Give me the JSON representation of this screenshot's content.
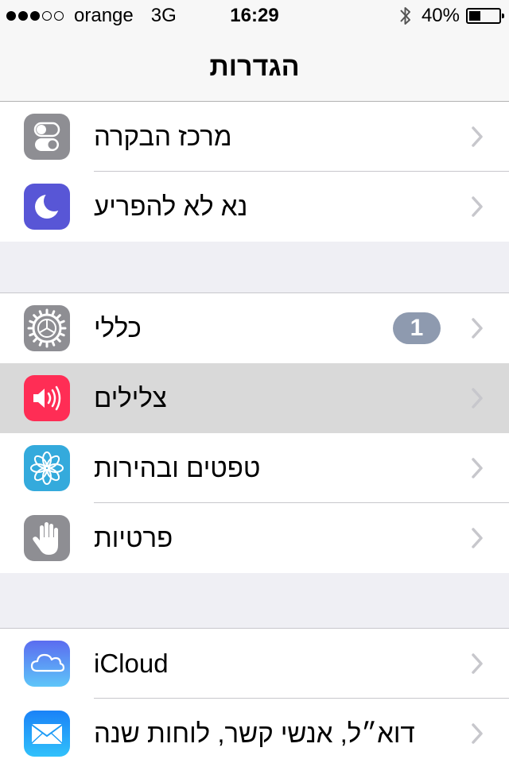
{
  "status_bar": {
    "signal_bars_filled": 3,
    "signal_bars_total": 5,
    "carrier": "orange",
    "network": "3G",
    "time": "16:29",
    "battery_percent": "40%",
    "battery_level": 0.4,
    "bluetooth_icon": "bluetooth-icon"
  },
  "nav": {
    "title": "הגדרות"
  },
  "colors": {
    "control_center": "#8e8e93",
    "do_not_disturb": "#5856d6",
    "general": "#8e8e93",
    "sounds": "#ff2d55",
    "wallpaper": "#34aadc",
    "privacy": "#8e8e93",
    "icloud": "#5fa8f5",
    "mail": "#1d9bf6",
    "badge": "#8e9aaf"
  },
  "groups": [
    {
      "items": [
        {
          "label": "מרכז הבקרה",
          "icon": "toggle-switches-icon"
        },
        {
          "label": "נא לא להפריע",
          "icon": "moon-icon"
        }
      ]
    },
    {
      "items": [
        {
          "label": "כללי",
          "icon": "gear-icon",
          "badge": "1"
        },
        {
          "label": "צלילים",
          "icon": "speaker-icon",
          "selected": true
        },
        {
          "label": "טפטים ובהירות",
          "icon": "flower-icon"
        },
        {
          "label": "פרטיות",
          "icon": "hand-icon"
        }
      ]
    },
    {
      "items": [
        {
          "label": "iCloud",
          "icon": "cloud-icon"
        },
        {
          "label": "דוא״ל, אנשי קשר, לוחות שנה",
          "icon": "envelope-icon"
        }
      ]
    }
  ]
}
